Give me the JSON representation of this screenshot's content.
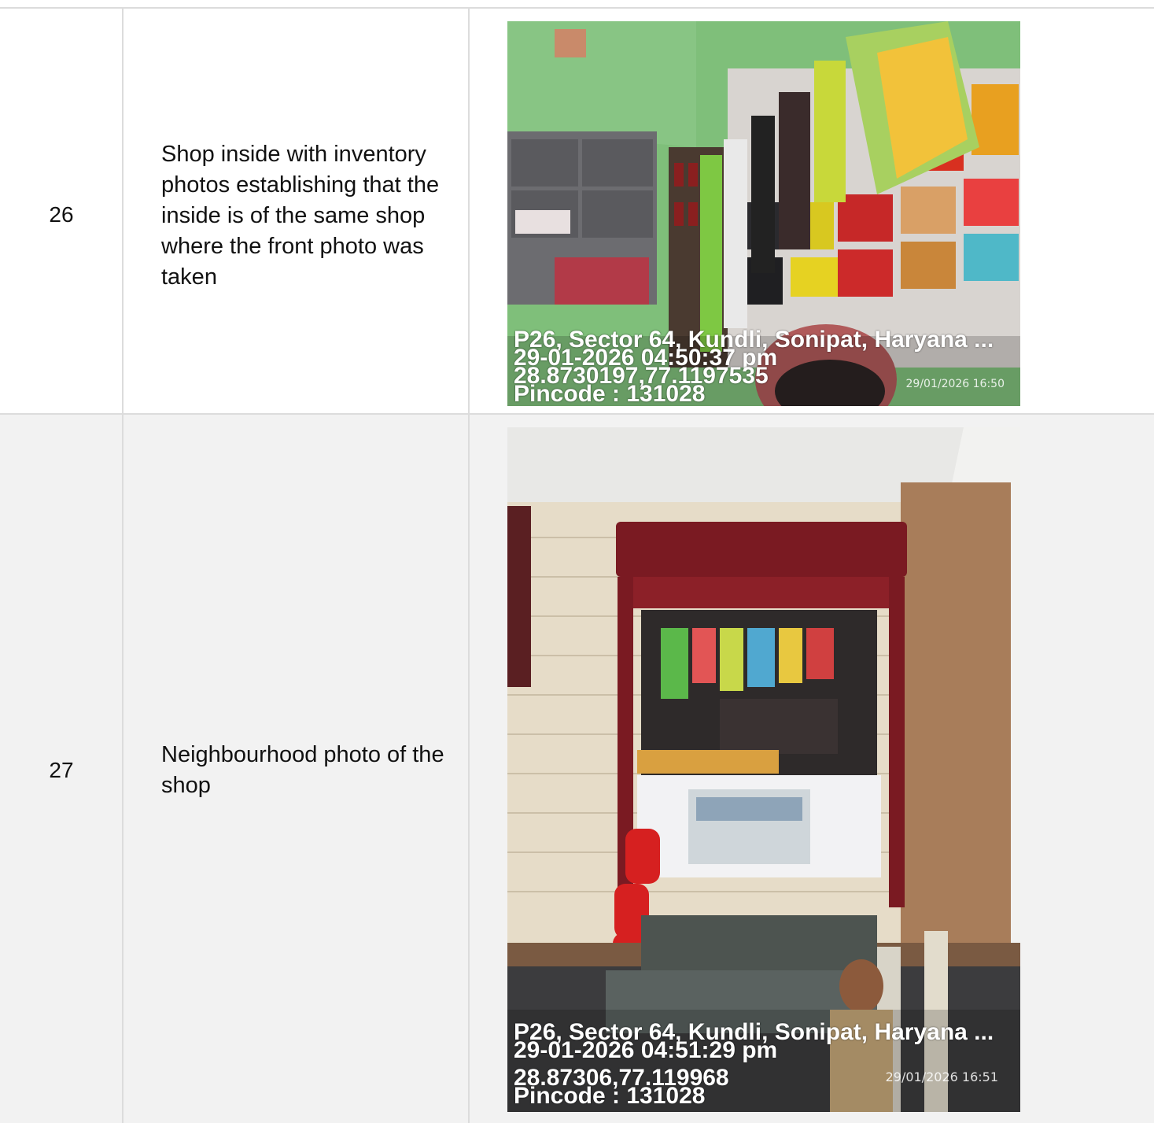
{
  "rows": [
    {
      "number": "26",
      "description": "Shop inside with inventory photos establishing that the inside is of the same shop where the front photo was taken",
      "photo": {
        "subject": "shop-interior-inventory",
        "stamp": {
          "address": "P26, Sector 64, Kundli, Sonipat, Haryana ...",
          "datetime": "29-01-2026 04:50:37 pm",
          "coords": "28.8730197,77.1197535",
          "pincode": "Pincode : 131028"
        },
        "camera_timestamp": "29/01/2026 16:50"
      }
    },
    {
      "number": "27",
      "description": "Neighbourhood photo of the shop",
      "photo": {
        "subject": "shop-front-neighbourhood",
        "stamp": {
          "address": "P26, Sector 64, Kundli, Sonipat, Haryana ...",
          "datetime": "29-01-2026 04:51:29 pm",
          "coords": "28.87306,77.119968",
          "pincode": "Pincode : 131028"
        },
        "camera_timestamp": "29/01/2026 16:51"
      }
    }
  ]
}
